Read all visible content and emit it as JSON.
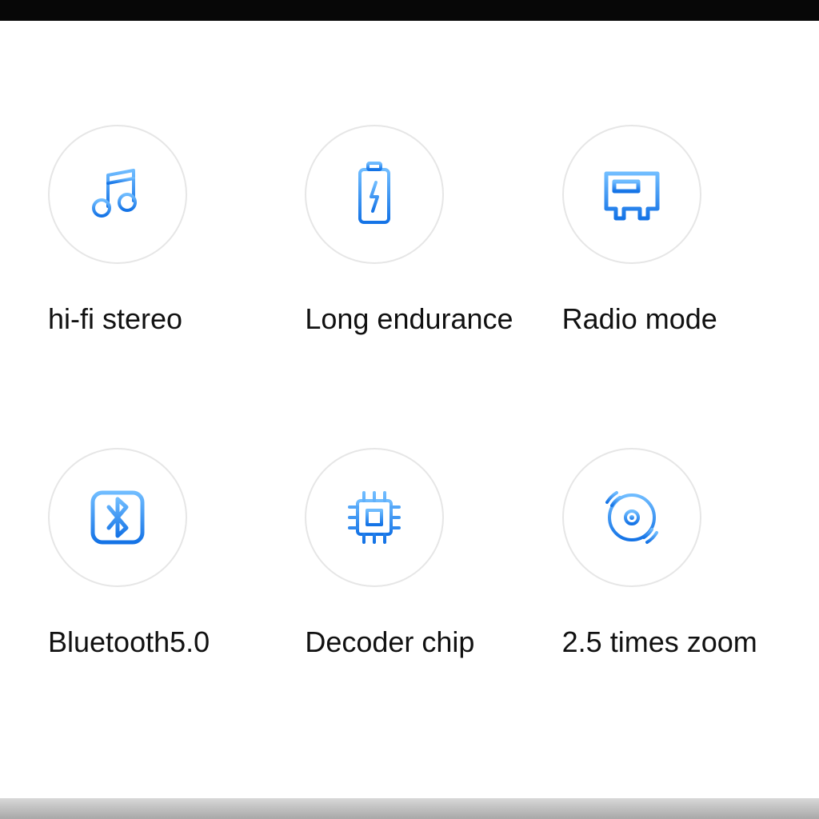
{
  "features": [
    {
      "label": "hi-fi stereo",
      "icon": "music-note-icon"
    },
    {
      "label": "Long endurance",
      "icon": "battery-icon"
    },
    {
      "label": "Radio mode",
      "icon": "radio-chip-icon"
    },
    {
      "label": "Bluetooth5.0",
      "icon": "bluetooth-icon"
    },
    {
      "label": "Decoder chip",
      "icon": "processor-icon"
    },
    {
      "label": "2.5 times zoom",
      "icon": "disc-icon"
    }
  ],
  "colors": {
    "gradient_start": "#6fbcff",
    "gradient_end": "#1473e6",
    "circle_border": "#e6e6e6"
  }
}
